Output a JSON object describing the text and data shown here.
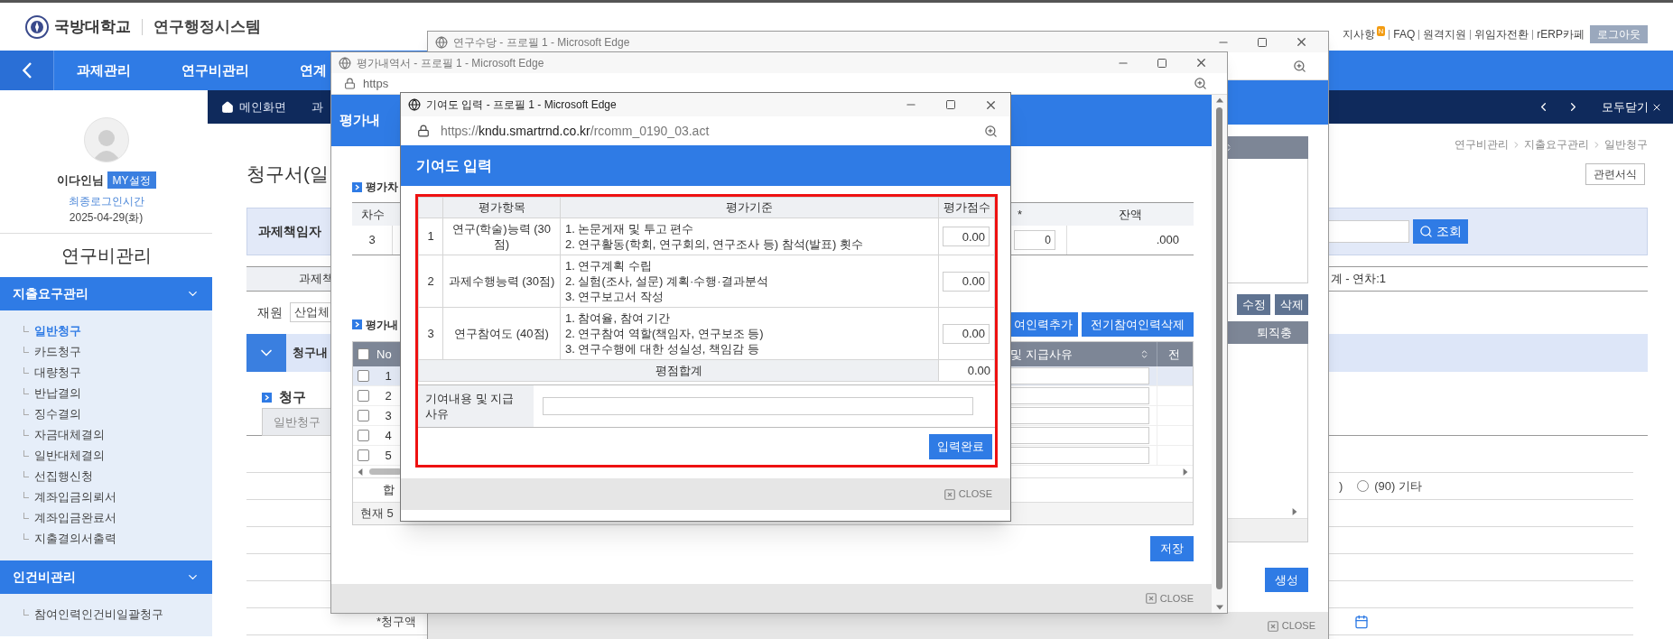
{
  "header": {
    "university": "국방대학교",
    "system": "연구행정시스템",
    "links": [
      {
        "label": "지사항",
        "badge": "N"
      },
      {
        "label": "FAQ"
      },
      {
        "label": "원격지원"
      },
      {
        "label": "위임자전환"
      },
      {
        "label": "rERP카페"
      }
    ],
    "logout": "로그아웃"
  },
  "nav": {
    "items": [
      "과제관리",
      "연구비관리",
      "연계"
    ]
  },
  "tabbar": {
    "tabs": [
      {
        "label": "메인화면",
        "kind": "home"
      },
      {
        "label": "과",
        "kind": "page"
      }
    ],
    "close_all": "모두닫기"
  },
  "sidebar": {
    "user": "이다인님",
    "my_button": "MY설정",
    "last_login_label": "최종로그인시간",
    "last_login": "2025-04-29(화)",
    "title": "연구비관리",
    "groups": [
      {
        "label": "지출요구관리",
        "expanded": true,
        "items": [
          {
            "label": "일반청구",
            "selected": true
          },
          {
            "label": "카드청구",
            "selected": false
          },
          {
            "label": "대량청구",
            "selected": false
          },
          {
            "label": "반납결의",
            "selected": false
          },
          {
            "label": "징수결의",
            "selected": false
          },
          {
            "label": "자금대체결의",
            "selected": false
          },
          {
            "label": "일반대체결의",
            "selected": false
          },
          {
            "label": "선집행신청",
            "selected": false
          },
          {
            "label": "계좌입금의뢰서",
            "selected": false
          },
          {
            "label": "계좌입금완료서",
            "selected": false
          },
          {
            "label": "지출결의서출력",
            "selected": false
          }
        ]
      },
      {
        "label": "인건비관리",
        "expanded": true,
        "items": [
          {
            "label": "참여인력인건비일괄청구",
            "selected": false
          }
        ]
      }
    ]
  },
  "main": {
    "breadcrumb": [
      "연구비관리",
      "지출요구관리",
      "일반청구"
    ],
    "title": "청구서(일",
    "related_forms_button": "관련서식",
    "search_label": "과제책임자",
    "search_button": "조회",
    "project_header": "과제책",
    "project_info": "계 - 연차:1",
    "funding_label": "재원",
    "funding_value": "산업체",
    "band_title": "청구내",
    "section_title": "청구",
    "type_tab": "일반청구",
    "prev_option_tail": ")",
    "radio_option": {
      "label": "(90) 기타",
      "selected": false
    },
    "amount_label": "*청구액"
  },
  "allowance_window": {
    "title": "연구수당 - 프로필 1 - Microsoft Edge",
    "buttons": [
      "수정",
      "삭제"
    ],
    "grid_column": "퇴직충",
    "create_button": "생성",
    "close": "CLOSE"
  },
  "evaluation_window": {
    "title": "평가내역서 - 프로필 1 - Microsoft Edge",
    "url": "https",
    "header": "평가내",
    "round_section": "평가차",
    "round_columns": [
      "차수",
      "*",
      "잔액"
    ],
    "round_row": [
      "3",
      "0",
      ".000"
    ],
    "detail_section": "평가내",
    "buttons": [
      "여인력추가",
      "전기참여인력삭제"
    ],
    "grid_columns": [
      "No",
      "및 지급사유",
      "전"
    ],
    "all_checked": false,
    "rows": [
      {
        "no": "1",
        "checked": false,
        "selected": true
      },
      {
        "no": "2",
        "checked": false,
        "selected": false
      },
      {
        "no": "3",
        "checked": false,
        "selected": false
      },
      {
        "no": "4",
        "checked": false,
        "selected": false
      },
      {
        "no": "5",
        "checked": false,
        "selected": false
      }
    ],
    "sum_label": "합",
    "count_text": "현재 5",
    "save_button": "저장",
    "close": "CLOSE"
  },
  "contribution_window": {
    "title": "기여도 입력 - 프로필 1 - Microsoft Edge",
    "url": {
      "scheme": "https://",
      "host": "kndu.smartrnd.co.kr",
      "path": "/rcomm_0190_03.act"
    },
    "header": "기여도 입력",
    "columns": [
      "평가항목",
      "평가기준",
      "평가점수"
    ],
    "rows": [
      {
        "no": "1",
        "item": "연구(학술)능력 (30점)",
        "criteria": [
          "1. 논문게재 및 투고 편수",
          "2. 연구활동(학회, 연구회의, 연구조사 등) 참석(발표) 횟수"
        ],
        "score": "0.00"
      },
      {
        "no": "2",
        "item": "과제수행능력 (30점)",
        "criteria": [
          "1. 연구계획 수립",
          "2. 실험(조사, 설문) 계획·수행·결과분석",
          "3. 연구보고서 작성"
        ],
        "score": "0.00"
      },
      {
        "no": "3",
        "item": "연구참여도 (40점)",
        "criteria": [
          "1. 참여율, 참여 기간",
          "2. 연구참여 역할(책임자, 연구보조 등)",
          "3. 연구수행에 대한 성실성, 책임감 등"
        ],
        "score": "0.00"
      }
    ],
    "total_label": "평점합계",
    "total": "0.00",
    "reason_label": "기여내용 및 지급 사유",
    "submit_button": "입력완료",
    "close": "CLOSE"
  }
}
